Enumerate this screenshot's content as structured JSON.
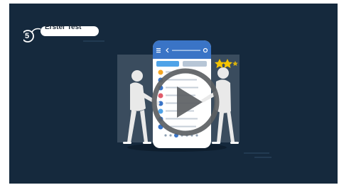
{
  "step": {
    "number": "5",
    "title": "Erster Test"
  },
  "colors": {
    "background": "#15293d",
    "accent": "#f5c400",
    "phone_header": "#3a74c6",
    "figure": "#e9e9e9"
  },
  "icons": {
    "play": "play-icon",
    "stars": "star-icon",
    "menu": "hamburger-icon",
    "back": "chevron-left-icon",
    "settings": "gear-icon"
  },
  "illustration": {
    "rating_stars_shown": 2,
    "rating_stars_total": 3,
    "pagination_dots": 7,
    "active_dot_index": 2
  }
}
